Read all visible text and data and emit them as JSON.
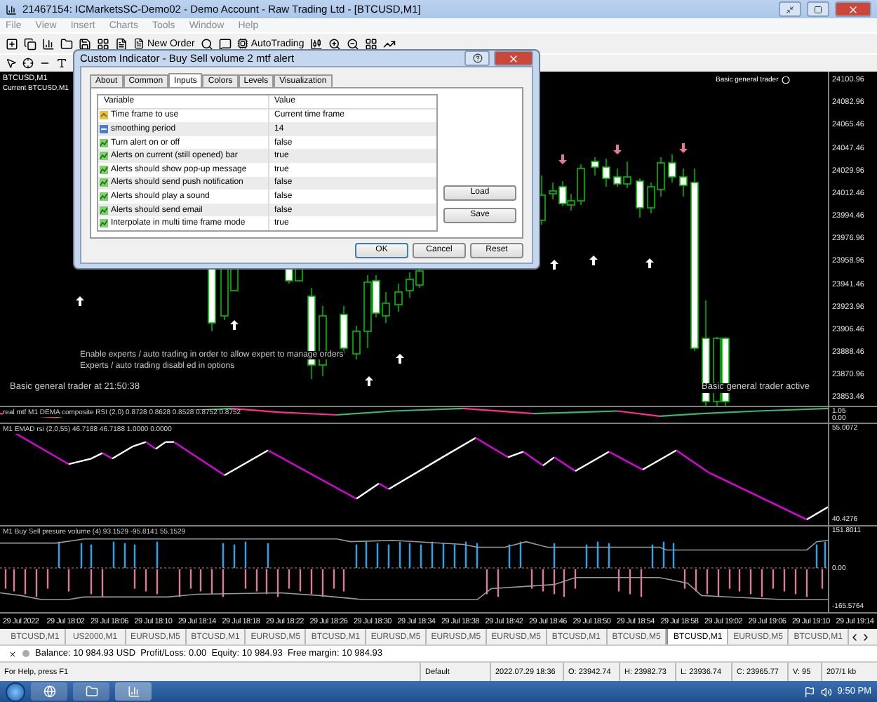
{
  "window": {
    "title": "21467154: ICMarketsSC-Demo02 - Demo Account - Raw Trading Ltd - [BTCUSD,M1]"
  },
  "menu": [
    "File",
    "View",
    "Insert",
    "Charts",
    "Tools",
    "Window",
    "Help"
  ],
  "toolbar": {
    "new_order": "New Order",
    "auto_trading": "AutoTrading"
  },
  "chart": {
    "symbol_label": "BTCUSD,M1",
    "subtitle": "Current BTCUSD,M1",
    "expert_badge": "Basic general trader",
    "price_axis": [
      "24100.96",
      "24082.96",
      "24065.46",
      "24047.46",
      "24029.96",
      "24012.46",
      "23994.46",
      "23976.96",
      "23958.96",
      "23941.46",
      "23923.96",
      "23906.46",
      "23888.46",
      "23870.96",
      "23853.46"
    ],
    "messages": [
      "Enable experts / auto trading in order to allow expert to manage orders",
      "Experts / auto trading disabl ed in options"
    ],
    "expert_time": "Basic general trader at 21:50:38",
    "expert_status": "Basic general trader active"
  },
  "indicators": [
    {
      "kind": "composite",
      "label": "real mtf M1 DEMA composite RSI (2,0) 0.8728 0.8628 0.8528 0.8752 0.8752",
      "scale": [
        "1.05",
        "0.00"
      ]
    },
    {
      "kind": "rsi",
      "label": "M1 EMAD rsi (2,0,55)  46.7188 46.7188 1.0000 0.0000",
      "scale": [
        "55.0072",
        "40.4276"
      ]
    },
    {
      "kind": "volume",
      "label": "M1 Buy Sell presure volume (4) 93.1529 -95.8141 55.1529",
      "scale": [
        "151.8011",
        "0.00",
        "-165.5764"
      ]
    }
  ],
  "time_axis": [
    "29 Jul 2022",
    "29 Jul 18:02",
    "29 Jul 18:06",
    "29 Jul 18:10",
    "29 Jul 18:14",
    "29 Jul 18:18",
    "29 Jul 18:22",
    "29 Jul 18:26",
    "29 Jul 18:30",
    "29 Jul 18:34",
    "29 Jul 18:38",
    "29 Jul 18:42",
    "29 Jul 18:46",
    "29 Jul 18:50",
    "29 Jul 18:54",
    "29 Jul 18:58",
    "29 Jul 19:02",
    "29 Jul 19:06",
    "29 Jul 19:10",
    "29 Jul 19:14"
  ],
  "chart_tabs": [
    {
      "label": "BTCUSD,M1",
      "selected": false
    },
    {
      "label": "US2000,M1",
      "selected": false
    },
    {
      "label": "EURUSD,M5",
      "selected": false
    },
    {
      "label": "BTCUSD,M1",
      "selected": false
    },
    {
      "label": "EURUSD,M5",
      "selected": false
    },
    {
      "label": "BTCUSD,M1",
      "selected": false
    },
    {
      "label": "EURUSD,M5",
      "selected": false
    },
    {
      "label": "EURUSD,M5",
      "selected": false
    },
    {
      "label": "EURUSD,M5",
      "selected": false
    },
    {
      "label": "BTCUSD,M1",
      "selected": false
    },
    {
      "label": "BTCUSD,M5",
      "selected": false
    },
    {
      "label": "BTCUSD,M1",
      "selected": true
    },
    {
      "label": "EURUSD,M5",
      "selected": false
    },
    {
      "label": "BTCUSD,M1",
      "selected": false
    }
  ],
  "terminal": {
    "balance": "Balance: 10 984.93 USD  Profit/Loss: 0.00  Equity: 10 984.93  Free margin: 10 984.93"
  },
  "status_bar": [
    "For Help, press F1",
    "Default",
    "2022.07.29 18:36",
    "O: 23942.74",
    "H: 23982.73",
    "L: 23936.74",
    "C: 23965.77",
    "V: 95",
    "207/1 kb"
  ],
  "taskbar": {
    "clock": "9:50 PM"
  },
  "dialog": {
    "title": "Custom Indicator - Buy Sell volume 2 mtf alert",
    "tabs": [
      {
        "label": "About",
        "selected": false
      },
      {
        "label": "Common",
        "selected": false
      },
      {
        "label": "Inputs",
        "selected": true
      },
      {
        "label": "Colors",
        "selected": false
      },
      {
        "label": "Levels",
        "selected": false
      },
      {
        "label": "Visualization",
        "selected": false
      }
    ],
    "columns": [
      "Variable",
      "Value"
    ],
    "rows": [
      {
        "kind": "enum",
        "variable": "Time frame to use",
        "value": "Current time frame"
      },
      {
        "kind": "int",
        "variable": "smoothing period",
        "value": "14"
      },
      {
        "kind": "bool",
        "variable": "Turn alert on or off",
        "value": "false"
      },
      {
        "kind": "bool",
        "variable": "Alerts on current (still opened) bar",
        "value": "true"
      },
      {
        "kind": "bool",
        "variable": "Alerts should show pop-up message",
        "value": "true"
      },
      {
        "kind": "bool",
        "variable": "Alerts should send push notification",
        "value": "false"
      },
      {
        "kind": "bool",
        "variable": "Alerts should play a sound",
        "value": "false"
      },
      {
        "kind": "bool",
        "variable": "Alerts should send email",
        "value": "false"
      },
      {
        "kind": "bool",
        "variable": "Interpolate in multi time frame mode",
        "value": "true"
      }
    ],
    "side_buttons": [
      "Load",
      "Save"
    ],
    "buttons": [
      "OK",
      "Cancel",
      "Reset"
    ]
  }
}
